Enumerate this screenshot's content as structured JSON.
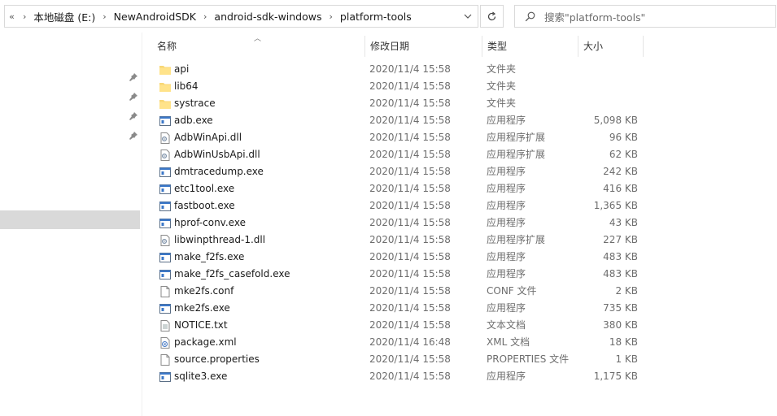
{
  "address_bar": {
    "back_glyph": "«",
    "crumbs": [
      "本地磁盘 (E:)",
      "NewAndroidSDK",
      "android-sdk-windows",
      "platform-tools"
    ],
    "separator": "›"
  },
  "search": {
    "placeholder": "搜索\"platform-tools\""
  },
  "columns": {
    "name": "名称",
    "date": "修改日期",
    "type": "类型",
    "size": "大小"
  },
  "files": [
    {
      "name": "api",
      "date": "2020/11/4 15:58",
      "type": "文件夹",
      "size": "",
      "icon": "folder-icon"
    },
    {
      "name": "lib64",
      "date": "2020/11/4 15:58",
      "type": "文件夹",
      "size": "",
      "icon": "folder-icon"
    },
    {
      "name": "systrace",
      "date": "2020/11/4 15:58",
      "type": "文件夹",
      "size": "",
      "icon": "folder-icon"
    },
    {
      "name": "adb.exe",
      "date": "2020/11/4 15:58",
      "type": "应用程序",
      "size": "5,098 KB",
      "icon": "exe-icon"
    },
    {
      "name": "AdbWinApi.dll",
      "date": "2020/11/4 15:58",
      "type": "应用程序扩展",
      "size": "96 KB",
      "icon": "dll-icon"
    },
    {
      "name": "AdbWinUsbApi.dll",
      "date": "2020/11/4 15:58",
      "type": "应用程序扩展",
      "size": "62 KB",
      "icon": "dll-icon"
    },
    {
      "name": "dmtracedump.exe",
      "date": "2020/11/4 15:58",
      "type": "应用程序",
      "size": "242 KB",
      "icon": "exe-icon"
    },
    {
      "name": "etc1tool.exe",
      "date": "2020/11/4 15:58",
      "type": "应用程序",
      "size": "416 KB",
      "icon": "exe-icon"
    },
    {
      "name": "fastboot.exe",
      "date": "2020/11/4 15:58",
      "type": "应用程序",
      "size": "1,365 KB",
      "icon": "exe-icon"
    },
    {
      "name": "hprof-conv.exe",
      "date": "2020/11/4 15:58",
      "type": "应用程序",
      "size": "43 KB",
      "icon": "exe-icon"
    },
    {
      "name": "libwinpthread-1.dll",
      "date": "2020/11/4 15:58",
      "type": "应用程序扩展",
      "size": "227 KB",
      "icon": "dll-icon"
    },
    {
      "name": "make_f2fs.exe",
      "date": "2020/11/4 15:58",
      "type": "应用程序",
      "size": "483 KB",
      "icon": "exe-icon"
    },
    {
      "name": "make_f2fs_casefold.exe",
      "date": "2020/11/4 15:58",
      "type": "应用程序",
      "size": "483 KB",
      "icon": "exe-icon"
    },
    {
      "name": "mke2fs.conf",
      "date": "2020/11/4 15:58",
      "type": "CONF 文件",
      "size": "2 KB",
      "icon": "file-icon"
    },
    {
      "name": "mke2fs.exe",
      "date": "2020/11/4 15:58",
      "type": "应用程序",
      "size": "735 KB",
      "icon": "exe-icon"
    },
    {
      "name": "NOTICE.txt",
      "date": "2020/11/4 15:58",
      "type": "文本文档",
      "size": "380 KB",
      "icon": "text-file-icon"
    },
    {
      "name": "package.xml",
      "date": "2020/11/4 16:48",
      "type": "XML 文档",
      "size": "18 KB",
      "icon": "xml-file-icon"
    },
    {
      "name": "source.properties",
      "date": "2020/11/4 15:58",
      "type": "PROPERTIES 文件",
      "size": "1 KB",
      "icon": "file-icon"
    },
    {
      "name": "sqlite3.exe",
      "date": "2020/11/4 15:58",
      "type": "应用程序",
      "size": "1,175 KB",
      "icon": "exe-icon"
    }
  ]
}
